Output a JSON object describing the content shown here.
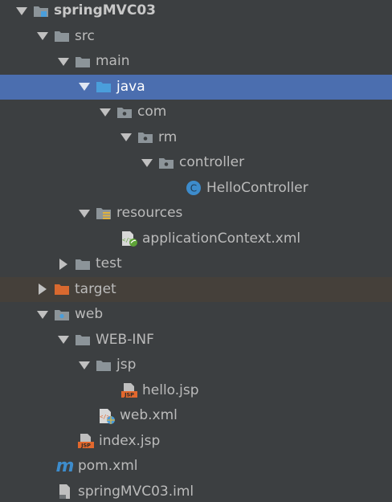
{
  "colors": {
    "background": "#3c3f41",
    "selection": "#4b6eaf",
    "excluded_row": "#45403a",
    "folder": "#8c9499",
    "source_folder": "#4a9edb",
    "excluded_folder": "#d9692f",
    "resource_bars": "#e0b23c",
    "class_badge": "#3d8ccc",
    "jsp_badge": "#e2682d",
    "xml_badge_green": "#5ea337"
  },
  "tree": {
    "project": "springMVC03",
    "src": "src",
    "main": "main",
    "java": "java",
    "com": "com",
    "rm": "rm",
    "controller": "controller",
    "hello_controller": "HelloController",
    "class_badge_letter": "C",
    "resources": "resources",
    "application_context": "applicationContext.xml",
    "test": "test",
    "target": "target",
    "web": "web",
    "web_inf": "WEB-INF",
    "jsp_folder": "jsp",
    "hello_jsp": "hello.jsp",
    "jsp_badge_text": "JSP",
    "web_xml": "web.xml",
    "index_jsp": "index.jsp",
    "pom_letter": "m",
    "pom": "pom.xml",
    "iml": "springMVC03.iml"
  }
}
